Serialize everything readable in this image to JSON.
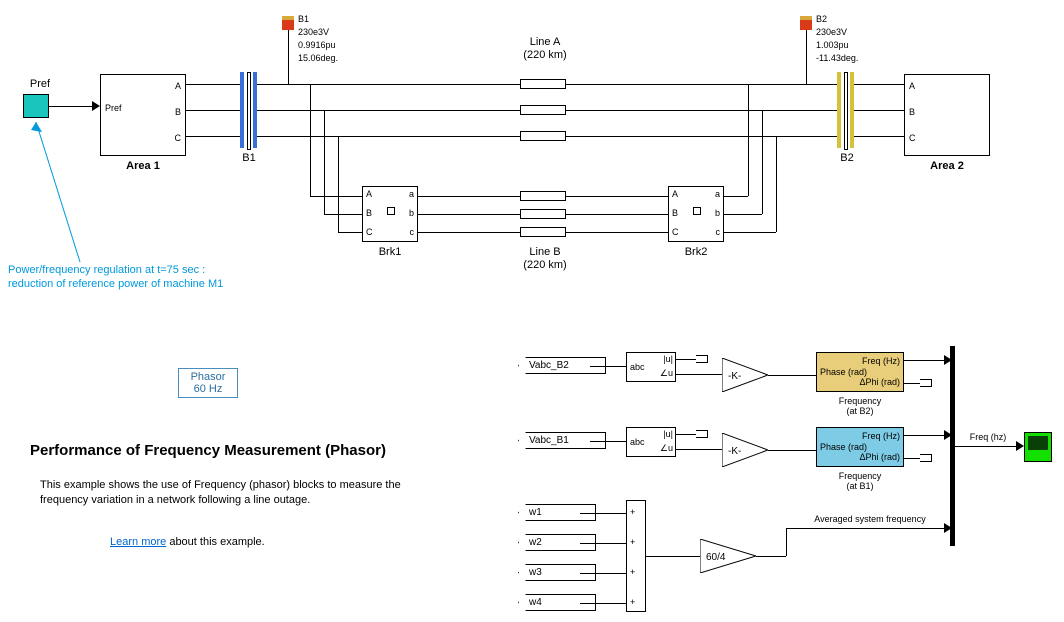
{
  "title": "Performance of Frequency Measurement (Phasor)",
  "description": "This example shows the use of Frequency (phasor) blocks to measure the frequency variation in a network following a line outage.",
  "learn_more_link": "Learn more",
  "learn_more_suffix": " about this example.",
  "annotation": {
    "line1": "Power/frequency regulation at t=75 sec :",
    "line2": "reduction of reference power of machine M1"
  },
  "phasor_block": {
    "line1": "Phasor",
    "line2": "60 Hz"
  },
  "pref_label": "Pref",
  "areas": {
    "area1": "Area 1",
    "area2": "Area 2",
    "pref_port": "Pref",
    "A": "A",
    "B": "B",
    "C": "C"
  },
  "buses": {
    "B1": {
      "name": "B1",
      "v": "230e3V",
      "pu": "0.9916pu",
      "deg": "15.06deg."
    },
    "B2": {
      "name": "B2",
      "v": "230e3V",
      "pu": "1.003pu",
      "deg": "-11.43deg."
    }
  },
  "lines": {
    "lineA": {
      "name": "Line A",
      "km": "(220 km)"
    },
    "lineB": {
      "name": "Line B",
      "km": "(220 km)"
    }
  },
  "breakers": {
    "brk1": "Brk1",
    "brk2": "Brk2",
    "a": "a",
    "A": "A",
    "B": "B",
    "C": "C",
    "b": "b",
    "c": "c"
  },
  "measure": {
    "vabc_b2": "Vabc_B2",
    "vabc_b1": "Vabc_B1",
    "abc": "abc",
    "mag": "|u|",
    "ang": "∠u",
    "gainK": "-K-",
    "gain60": "60/4",
    "freqblk": {
      "in": "Phase (rad)",
      "out1": "Freq (Hz)",
      "out2": "ΔPhi (rad)"
    },
    "freq_at_b2": "Frequency\n(at B2)",
    "freq_at_b1": "Frequency\n(at B1)",
    "avg_label": "Averaged system frequency",
    "out_label": "Freq (hz)",
    "w": [
      "w1",
      "w2",
      "w3",
      "w4"
    ],
    "plus": "+"
  }
}
